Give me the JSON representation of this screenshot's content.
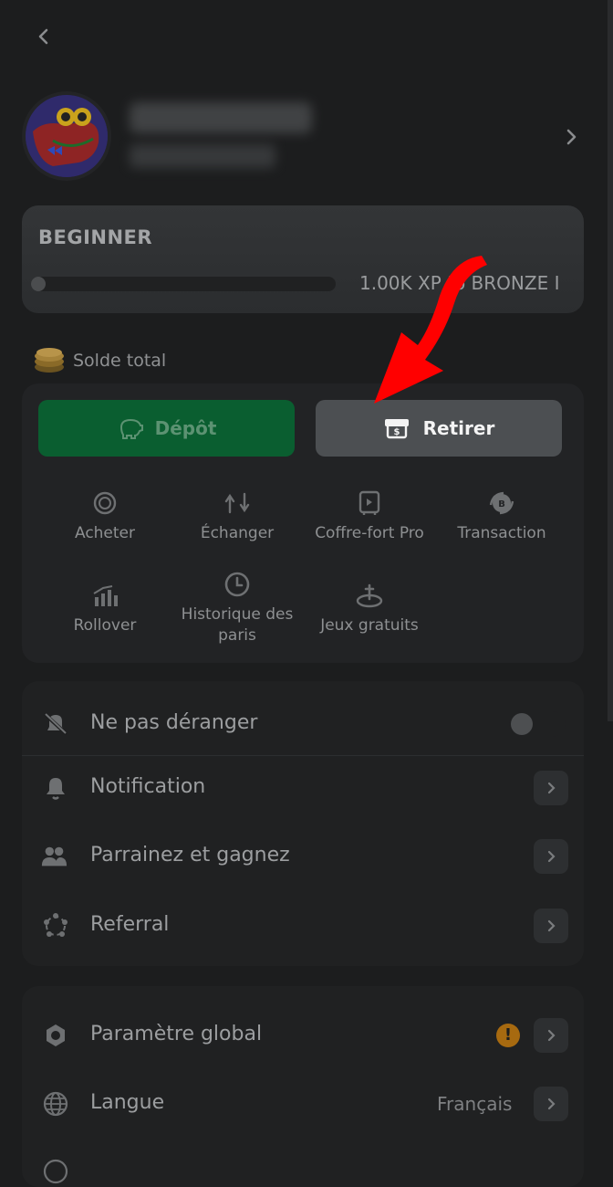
{
  "header": {
    "back_icon": "chevron-left-icon"
  },
  "profile": {
    "avatar_icon": "monster-avatar",
    "chevron_icon": "chevron-right-icon"
  },
  "vip": {
    "level": "BEGINNER",
    "progress": 0,
    "progress_text": "1.00K XP to BRONZE I"
  },
  "wallet": {
    "balance_label": "Solde total",
    "deposit_label": "Dépôt",
    "withdraw_label": "Retirer",
    "actions": [
      {
        "label": "Acheter",
        "icon": "coin-icon"
      },
      {
        "label": "Échanger",
        "icon": "swap-icon"
      },
      {
        "label": "Coffre-fort Pro",
        "icon": "vault-icon"
      },
      {
        "label": "Transaction",
        "icon": "transaction-icon"
      },
      {
        "label": "Rollover",
        "icon": "chart-icon"
      },
      {
        "label": "Historique des paris",
        "icon": "clock-icon"
      },
      {
        "label": "Jeux gratuits",
        "icon": "joystick-icon"
      }
    ]
  },
  "settings1": {
    "dnd_label": "Ne pas déranger",
    "dnd_on": false,
    "notification_label": "Notification",
    "invite_label": "Parrainez et gagnez",
    "referral_label": "Referral"
  },
  "settings2": {
    "global_label": "Paramètre global",
    "language_label": "Langue",
    "language_value": "Français"
  },
  "colors": {
    "deposit": "#0a5e30",
    "withdraw": "#4c4f52",
    "annotation_arrow": "#ff0000",
    "warning": "#a76a10"
  }
}
